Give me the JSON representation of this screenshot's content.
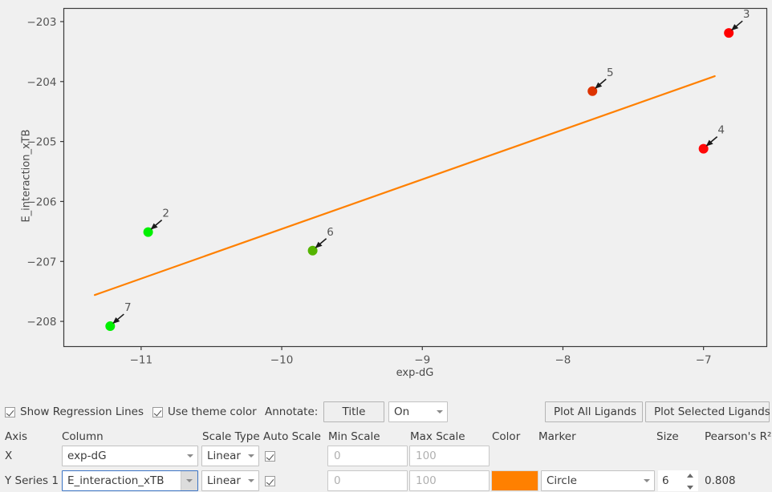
{
  "chart_data": {
    "type": "scatter",
    "title": "",
    "xlabel": "exp-dG",
    "ylabel": "E_interaction_xTB",
    "xlim": [
      -11.55,
      -6.55
    ],
    "ylim": [
      -208.42,
      -202.78
    ],
    "xticks": [
      -11,
      -10,
      -9,
      -8,
      -7
    ],
    "xticklabels": [
      "−11",
      "−10",
      "−9",
      "−8",
      "−7"
    ],
    "yticks": [
      -203,
      -204,
      -205,
      -206,
      -207,
      -208
    ],
    "yticklabels": [
      "−203",
      "−204",
      "−205",
      "−206",
      "−207",
      "−208"
    ],
    "grid": false,
    "legend": "none",
    "frame": true,
    "points": [
      {
        "label": "3",
        "x": -6.82,
        "y": -203.19,
        "color": "#FF0000"
      },
      {
        "label": "5",
        "x": -7.79,
        "y": -204.16,
        "color": "#DD3300"
      },
      {
        "label": "4",
        "x": -7.0,
        "y": -205.12,
        "color": "#FF0808"
      },
      {
        "label": "2",
        "x": -10.95,
        "y": -206.51,
        "color": "#00F000"
      },
      {
        "label": "6",
        "x": -9.78,
        "y": -206.82,
        "color": "#55B400"
      },
      {
        "label": "7",
        "x": -11.22,
        "y": -208.08,
        "color": "#00F000"
      }
    ],
    "regression_line": {
      "color": "#FF8000",
      "x_start": -11.33,
      "y_start": -207.56,
      "x_end": -6.92,
      "y_end": -203.91
    },
    "annotations_style": "arrow-with-number",
    "point_marker": "circle",
    "point_size": 6,
    "pearson_r2": "0.808"
  },
  "options_row": {
    "show_regression_label": "Show Regression Lines",
    "show_regression_checked": true,
    "use_theme_color_label": "Use theme color",
    "use_theme_color_checked": true,
    "annotate_label": "Annotate:",
    "title_button": "Title",
    "annotate_mode": "On",
    "plot_all_button": "Plot All Ligands",
    "plot_selected_button": "Plot Selected Ligands"
  },
  "table": {
    "headers": {
      "axis": "Axis",
      "column": "Column",
      "scale_type": "Scale Type",
      "auto_scale": "Auto Scale",
      "min_scale": "Min Scale",
      "max_scale": "Max Scale",
      "color": "Color",
      "marker": "Marker",
      "size": "Size",
      "pearson": "Pearson's R²"
    },
    "rows": [
      {
        "axis": "X",
        "column": "exp-dG",
        "scale_type": "Linear",
        "auto_scale": true,
        "min_scale_placeholder": "0",
        "max_scale_placeholder": "100",
        "min_scale_value": "",
        "max_scale_value": "",
        "color": "",
        "marker": "",
        "size": "",
        "pearson": "",
        "focused": false
      },
      {
        "axis": "Y Series 1",
        "column": "E_interaction_xTB",
        "scale_type": "Linear",
        "auto_scale": true,
        "min_scale_placeholder": "0",
        "max_scale_placeholder": "100",
        "min_scale_value": "",
        "max_scale_value": "",
        "color": "#FF8000",
        "marker": "Circle",
        "size": "6",
        "pearson": "0.808",
        "focused": true
      }
    ]
  }
}
